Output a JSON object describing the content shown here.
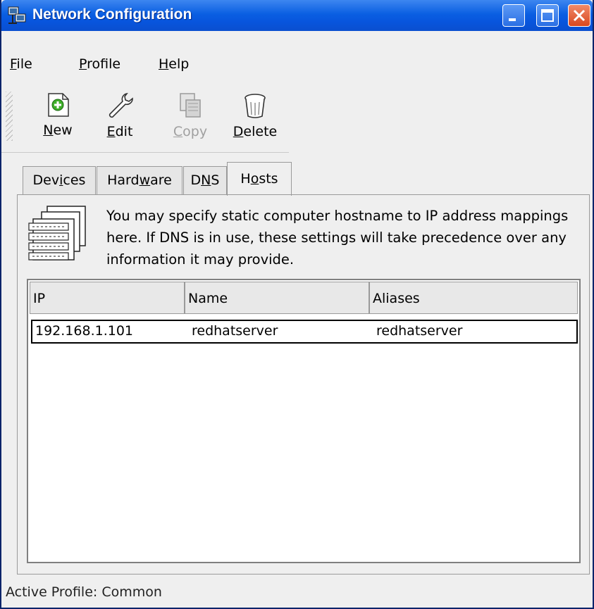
{
  "window": {
    "title": "Network Configuration"
  },
  "menubar": {
    "items": [
      {
        "label": "File",
        "mnemonic": "F",
        "rest": "ile"
      },
      {
        "label": "Profile",
        "mnemonic": "P",
        "rest": "rofile"
      },
      {
        "label": "Help",
        "mnemonic": "H",
        "rest": "elp"
      }
    ]
  },
  "toolbar": {
    "new": {
      "label": "New",
      "mnemonic": "N",
      "rest": "ew",
      "icon": "new-icon"
    },
    "edit": {
      "label": "Edit",
      "mnemonic": "E",
      "rest": "dit",
      "icon": "wrench-icon"
    },
    "copy": {
      "label": "Copy",
      "mnemonic": "C",
      "rest": "opy",
      "icon": "copy-icon",
      "disabled": true
    },
    "delete": {
      "label": "Delete",
      "mnemonic": "D",
      "rest": "elete",
      "icon": "trash-icon"
    }
  },
  "tabs": [
    {
      "label": "Devices",
      "pre": "Dev",
      "mn": "i",
      "post": "ces",
      "active": false
    },
    {
      "label": "Hardware",
      "pre": "Hard",
      "mn": "w",
      "post": "are",
      "active": false
    },
    {
      "label": "DNS",
      "pre": "D",
      "mn": "N",
      "post": "S",
      "active": false
    },
    {
      "label": "Hosts",
      "pre": "H",
      "mn": "o",
      "post": "sts",
      "active": true
    }
  ],
  "hosts": {
    "description": "You may specify static computer hostname to IP address mappings here.  If DNS is in use, these settings will take precedence over any information it may provide.",
    "columns": [
      "IP",
      "Name",
      "Aliases"
    ],
    "rows": [
      {
        "ip": "192.168.1.101",
        "name": "redhatserver",
        "aliases": "redhatserver"
      }
    ]
  },
  "status": {
    "text": "Active Profile: Common"
  }
}
